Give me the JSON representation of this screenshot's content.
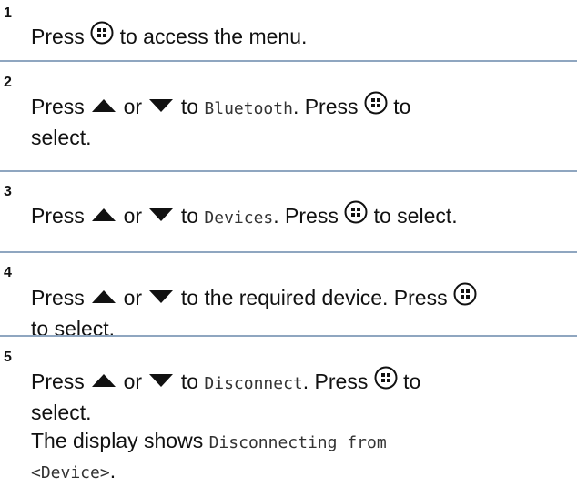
{
  "steps": [
    {
      "number": "1",
      "t1": "Press",
      "t2": "to access the menu."
    },
    {
      "number": "2",
      "t1": "Press",
      "or": "or",
      "to": "to",
      "code": "Bluetooth",
      "t2": ". Press",
      "t3": "to",
      "t4": "select."
    },
    {
      "number": "3",
      "t1": "Press",
      "or": "or",
      "to": "to",
      "code": "Devices",
      "t2": ". Press",
      "t3": "to select."
    },
    {
      "number": "4",
      "t1": "Press",
      "or": "or",
      "t2": "to the required device. Press",
      "t3": "to select."
    },
    {
      "number": "5",
      "t1": "Press",
      "or": "or",
      "to": "to",
      "code": "Disconnect",
      "t2": ". Press",
      "t3": "to",
      "t4": "select.",
      "t5": "The display shows",
      "code2": "Disconnecting from",
      "code3": "<Device>",
      "t6": "."
    }
  ],
  "icons": {
    "menu": "menu-ok-button-icon",
    "up": "up-arrow-icon",
    "down": "down-arrow-icon"
  }
}
